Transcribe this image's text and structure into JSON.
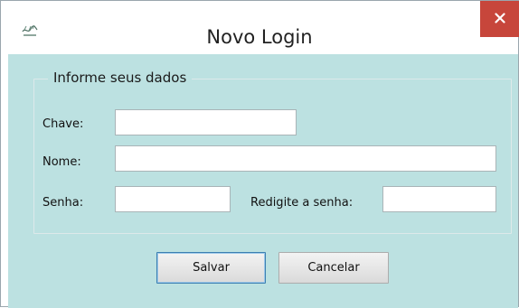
{
  "window": {
    "title": "Novo Login"
  },
  "form": {
    "group_title": "Informe seus dados",
    "chave": {
      "label": "Chave:",
      "value": ""
    },
    "nome": {
      "label": "Nome:",
      "value": ""
    },
    "senha": {
      "label": "Senha:",
      "value": ""
    },
    "redigite": {
      "label": "Redigite a senha:",
      "value": ""
    }
  },
  "actions": {
    "save_label": "Salvar",
    "cancel_label": "Cancelar"
  },
  "colors": {
    "client_background": "#bce1e1",
    "close_button": "#c7463b"
  },
  "icons": {
    "app": "app-logo-icon",
    "close": "close-icon"
  }
}
